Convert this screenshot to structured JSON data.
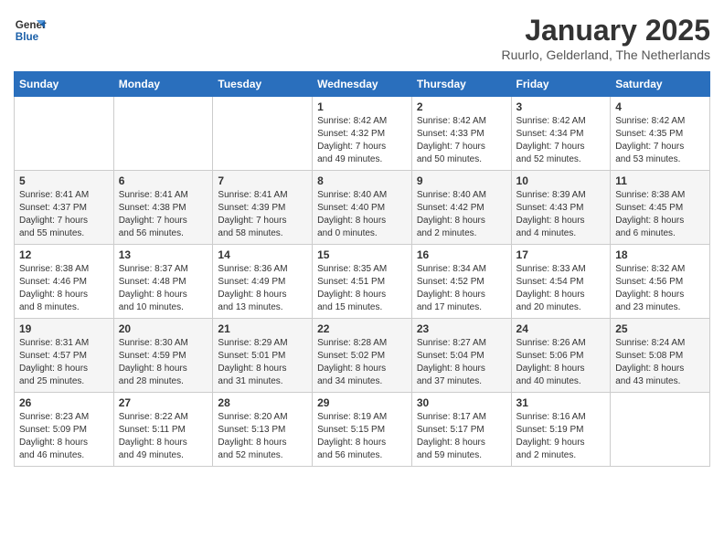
{
  "logo": {
    "line1": "General",
    "line2": "Blue"
  },
  "title": "January 2025",
  "subtitle": "Ruurlo, Gelderland, The Netherlands",
  "weekdays": [
    "Sunday",
    "Monday",
    "Tuesday",
    "Wednesday",
    "Thursday",
    "Friday",
    "Saturday"
  ],
  "weeks": [
    [
      {
        "day": "",
        "info": ""
      },
      {
        "day": "",
        "info": ""
      },
      {
        "day": "",
        "info": ""
      },
      {
        "day": "1",
        "info": "Sunrise: 8:42 AM\nSunset: 4:32 PM\nDaylight: 7 hours\nand 49 minutes."
      },
      {
        "day": "2",
        "info": "Sunrise: 8:42 AM\nSunset: 4:33 PM\nDaylight: 7 hours\nand 50 minutes."
      },
      {
        "day": "3",
        "info": "Sunrise: 8:42 AM\nSunset: 4:34 PM\nDaylight: 7 hours\nand 52 minutes."
      },
      {
        "day": "4",
        "info": "Sunrise: 8:42 AM\nSunset: 4:35 PM\nDaylight: 7 hours\nand 53 minutes."
      }
    ],
    [
      {
        "day": "5",
        "info": "Sunrise: 8:41 AM\nSunset: 4:37 PM\nDaylight: 7 hours\nand 55 minutes."
      },
      {
        "day": "6",
        "info": "Sunrise: 8:41 AM\nSunset: 4:38 PM\nDaylight: 7 hours\nand 56 minutes."
      },
      {
        "day": "7",
        "info": "Sunrise: 8:41 AM\nSunset: 4:39 PM\nDaylight: 7 hours\nand 58 minutes."
      },
      {
        "day": "8",
        "info": "Sunrise: 8:40 AM\nSunset: 4:40 PM\nDaylight: 8 hours\nand 0 minutes."
      },
      {
        "day": "9",
        "info": "Sunrise: 8:40 AM\nSunset: 4:42 PM\nDaylight: 8 hours\nand 2 minutes."
      },
      {
        "day": "10",
        "info": "Sunrise: 8:39 AM\nSunset: 4:43 PM\nDaylight: 8 hours\nand 4 minutes."
      },
      {
        "day": "11",
        "info": "Sunrise: 8:38 AM\nSunset: 4:45 PM\nDaylight: 8 hours\nand 6 minutes."
      }
    ],
    [
      {
        "day": "12",
        "info": "Sunrise: 8:38 AM\nSunset: 4:46 PM\nDaylight: 8 hours\nand 8 minutes."
      },
      {
        "day": "13",
        "info": "Sunrise: 8:37 AM\nSunset: 4:48 PM\nDaylight: 8 hours\nand 10 minutes."
      },
      {
        "day": "14",
        "info": "Sunrise: 8:36 AM\nSunset: 4:49 PM\nDaylight: 8 hours\nand 13 minutes."
      },
      {
        "day": "15",
        "info": "Sunrise: 8:35 AM\nSunset: 4:51 PM\nDaylight: 8 hours\nand 15 minutes."
      },
      {
        "day": "16",
        "info": "Sunrise: 8:34 AM\nSunset: 4:52 PM\nDaylight: 8 hours\nand 17 minutes."
      },
      {
        "day": "17",
        "info": "Sunrise: 8:33 AM\nSunset: 4:54 PM\nDaylight: 8 hours\nand 20 minutes."
      },
      {
        "day": "18",
        "info": "Sunrise: 8:32 AM\nSunset: 4:56 PM\nDaylight: 8 hours\nand 23 minutes."
      }
    ],
    [
      {
        "day": "19",
        "info": "Sunrise: 8:31 AM\nSunset: 4:57 PM\nDaylight: 8 hours\nand 25 minutes."
      },
      {
        "day": "20",
        "info": "Sunrise: 8:30 AM\nSunset: 4:59 PM\nDaylight: 8 hours\nand 28 minutes."
      },
      {
        "day": "21",
        "info": "Sunrise: 8:29 AM\nSunset: 5:01 PM\nDaylight: 8 hours\nand 31 minutes."
      },
      {
        "day": "22",
        "info": "Sunrise: 8:28 AM\nSunset: 5:02 PM\nDaylight: 8 hours\nand 34 minutes."
      },
      {
        "day": "23",
        "info": "Sunrise: 8:27 AM\nSunset: 5:04 PM\nDaylight: 8 hours\nand 37 minutes."
      },
      {
        "day": "24",
        "info": "Sunrise: 8:26 AM\nSunset: 5:06 PM\nDaylight: 8 hours\nand 40 minutes."
      },
      {
        "day": "25",
        "info": "Sunrise: 8:24 AM\nSunset: 5:08 PM\nDaylight: 8 hours\nand 43 minutes."
      }
    ],
    [
      {
        "day": "26",
        "info": "Sunrise: 8:23 AM\nSunset: 5:09 PM\nDaylight: 8 hours\nand 46 minutes."
      },
      {
        "day": "27",
        "info": "Sunrise: 8:22 AM\nSunset: 5:11 PM\nDaylight: 8 hours\nand 49 minutes."
      },
      {
        "day": "28",
        "info": "Sunrise: 8:20 AM\nSunset: 5:13 PM\nDaylight: 8 hours\nand 52 minutes."
      },
      {
        "day": "29",
        "info": "Sunrise: 8:19 AM\nSunset: 5:15 PM\nDaylight: 8 hours\nand 56 minutes."
      },
      {
        "day": "30",
        "info": "Sunrise: 8:17 AM\nSunset: 5:17 PM\nDaylight: 8 hours\nand 59 minutes."
      },
      {
        "day": "31",
        "info": "Sunrise: 8:16 AM\nSunset: 5:19 PM\nDaylight: 9 hours\nand 2 minutes."
      },
      {
        "day": "",
        "info": ""
      }
    ]
  ]
}
